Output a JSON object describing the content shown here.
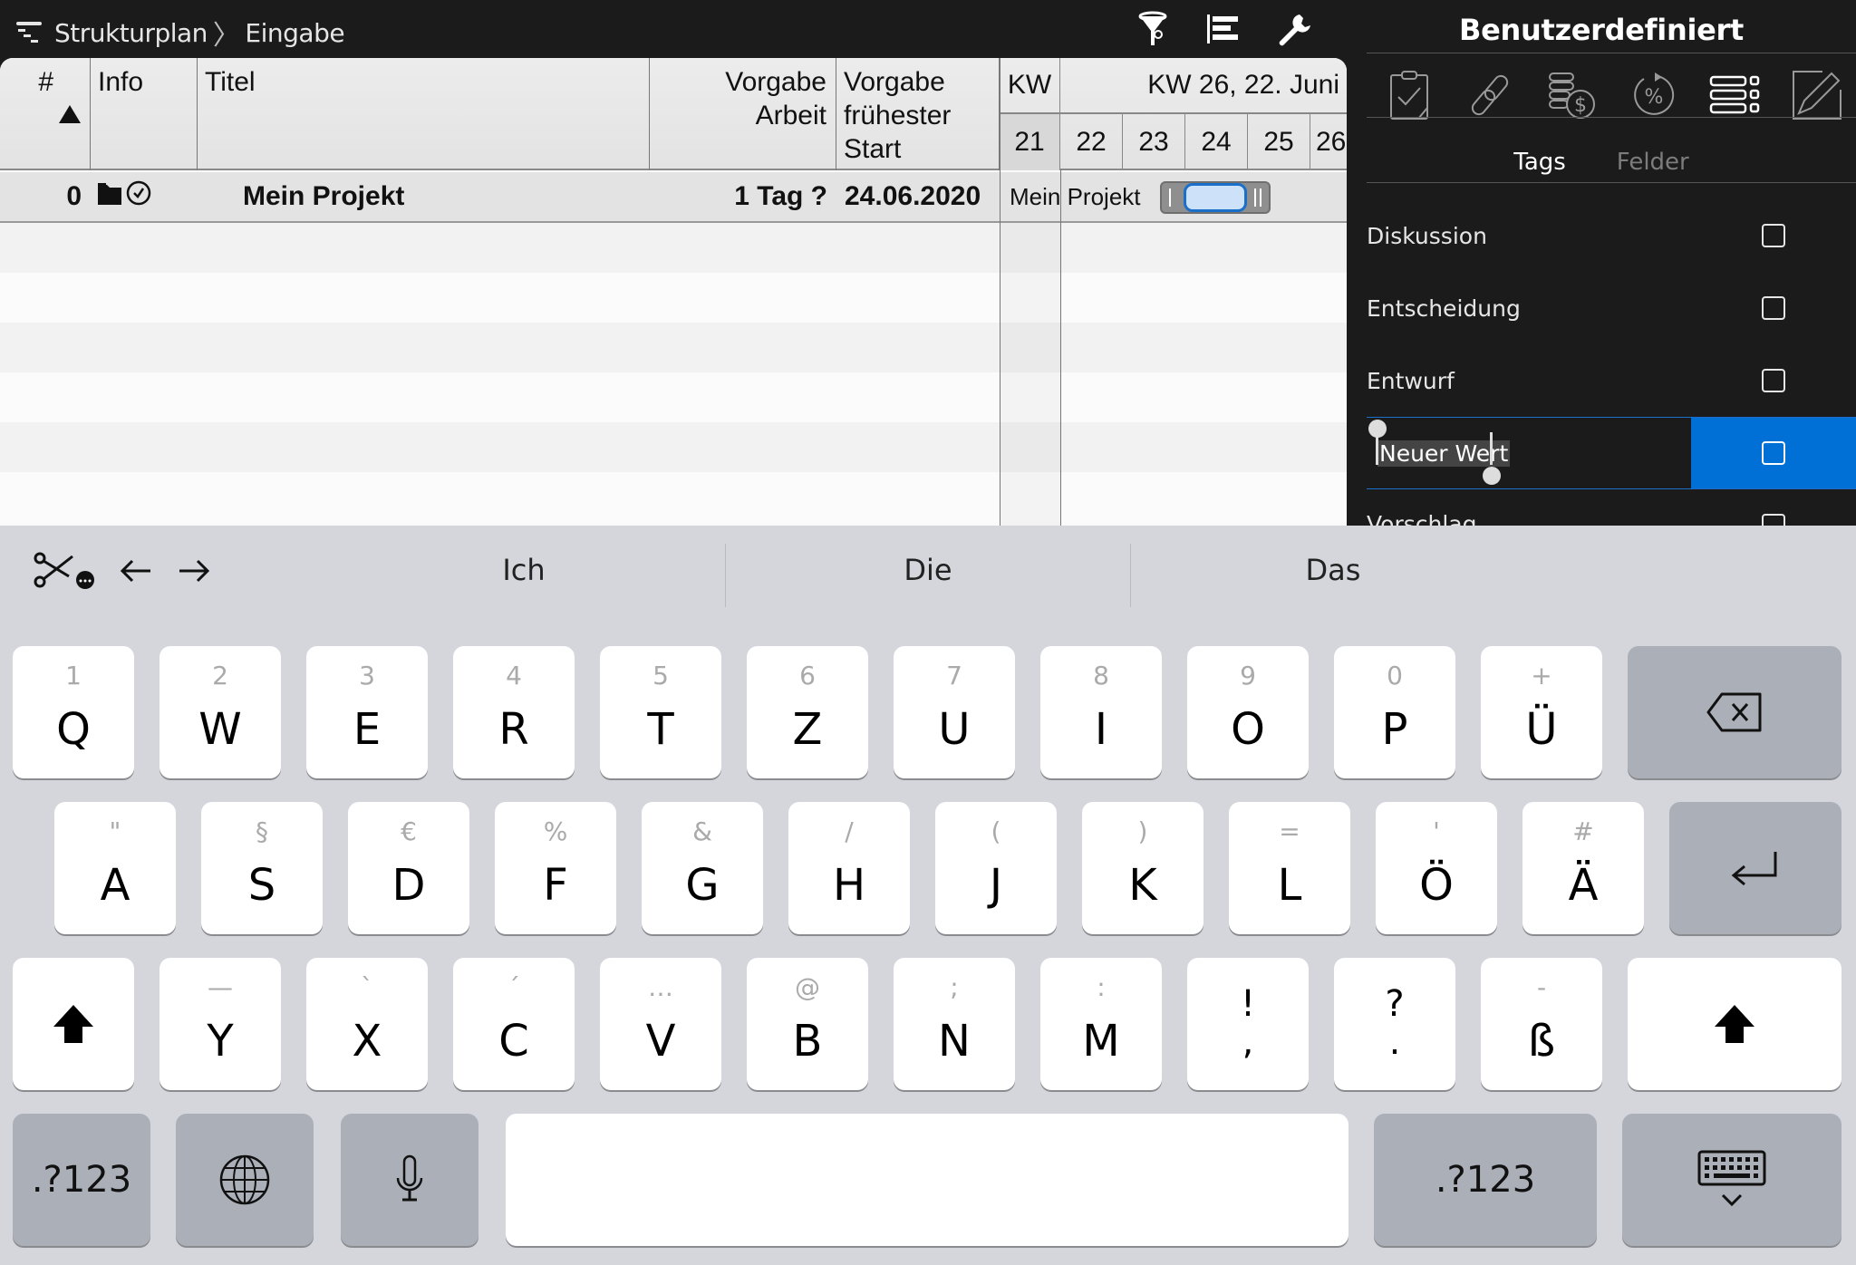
{
  "topbar": {
    "breadcrumb": [
      "Strukturplan",
      "Eingabe"
    ],
    "breadcrumb_separator": "〉",
    "icons": [
      "filter-icon",
      "gantt-align-icon",
      "wrench-icon"
    ]
  },
  "table": {
    "headers": {
      "num": "#",
      "info": "Info",
      "title": "Titel",
      "work_line1": "Vorgabe",
      "work_line2": "Arbeit",
      "start_line1": "Vorgabe",
      "start_line2": "frühester",
      "start_line3": "Start"
    },
    "sort_direction": "ascending",
    "rows": [
      {
        "num": "0",
        "info_icons": [
          "folder-icon",
          "clock-check-icon"
        ],
        "title": "Mein Projekt",
        "work": "1 Tag ?",
        "start": "24.06.2020"
      }
    ]
  },
  "gantt": {
    "header_kw": "KW",
    "header_week": "KW 26, 22. Juni",
    "days": [
      "21",
      "22",
      "23",
      "24",
      "25",
      "26"
    ],
    "bar_label": "Mein Projekt"
  },
  "panel": {
    "title": "Benutzerdefiniert",
    "icons": [
      "clipboard-check-icon",
      "link-icon",
      "coins-dollar-icon",
      "percent-cycle-icon",
      "list-fields-icon",
      "pencil-edit-icon"
    ],
    "segments": [
      {
        "label": "Tags",
        "active": true
      },
      {
        "label": "Felder",
        "active": false
      }
    ],
    "tags": [
      {
        "label": "Diskussion",
        "checked": false
      },
      {
        "label": "Entscheidung",
        "checked": false
      },
      {
        "label": "Entwurf",
        "checked": false
      },
      {
        "label": "Neuer Wert",
        "checked": false,
        "editing": true
      },
      {
        "label": "Vorschlag",
        "checked": false
      }
    ]
  },
  "keyboard": {
    "predictions": [
      "Ich",
      "Die",
      "Das"
    ],
    "row1": [
      {
        "hint": "1",
        "key": "Q"
      },
      {
        "hint": "2",
        "key": "W"
      },
      {
        "hint": "3",
        "key": "E"
      },
      {
        "hint": "4",
        "key": "R"
      },
      {
        "hint": "5",
        "key": "T"
      },
      {
        "hint": "6",
        "key": "Z"
      },
      {
        "hint": "7",
        "key": "U"
      },
      {
        "hint": "8",
        "key": "I"
      },
      {
        "hint": "9",
        "key": "O"
      },
      {
        "hint": "0",
        "key": "P"
      },
      {
        "hint": "+",
        "key": "Ü"
      }
    ],
    "row2": [
      {
        "hint": "\"",
        "key": "A"
      },
      {
        "hint": "§",
        "key": "S"
      },
      {
        "hint": "€",
        "key": "D"
      },
      {
        "hint": "%",
        "key": "F"
      },
      {
        "hint": "&",
        "key": "G"
      },
      {
        "hint": "/",
        "key": "H"
      },
      {
        "hint": "(",
        "key": "J"
      },
      {
        "hint": ")",
        "key": "K"
      },
      {
        "hint": "=",
        "key": "L"
      },
      {
        "hint": "'",
        "key": "Ö"
      },
      {
        "hint": "#",
        "key": "Ä"
      }
    ],
    "row3": [
      {
        "hint": "—",
        "key": "Y"
      },
      {
        "hint": "`",
        "key": "X"
      },
      {
        "hint": "´",
        "key": "C"
      },
      {
        "hint": "…",
        "key": "V"
      },
      {
        "hint": "@",
        "key": "B"
      },
      {
        "hint": ";",
        "key": "N"
      },
      {
        "hint": ":",
        "key": "M"
      }
    ],
    "punct1": {
      "top": "!",
      "bottom": ","
    },
    "punct2": {
      "top": "?",
      "bottom": "."
    },
    "sz": {
      "hint": "-",
      "key": "ß"
    },
    "numbers_label": ".?123",
    "space_label": ""
  }
}
